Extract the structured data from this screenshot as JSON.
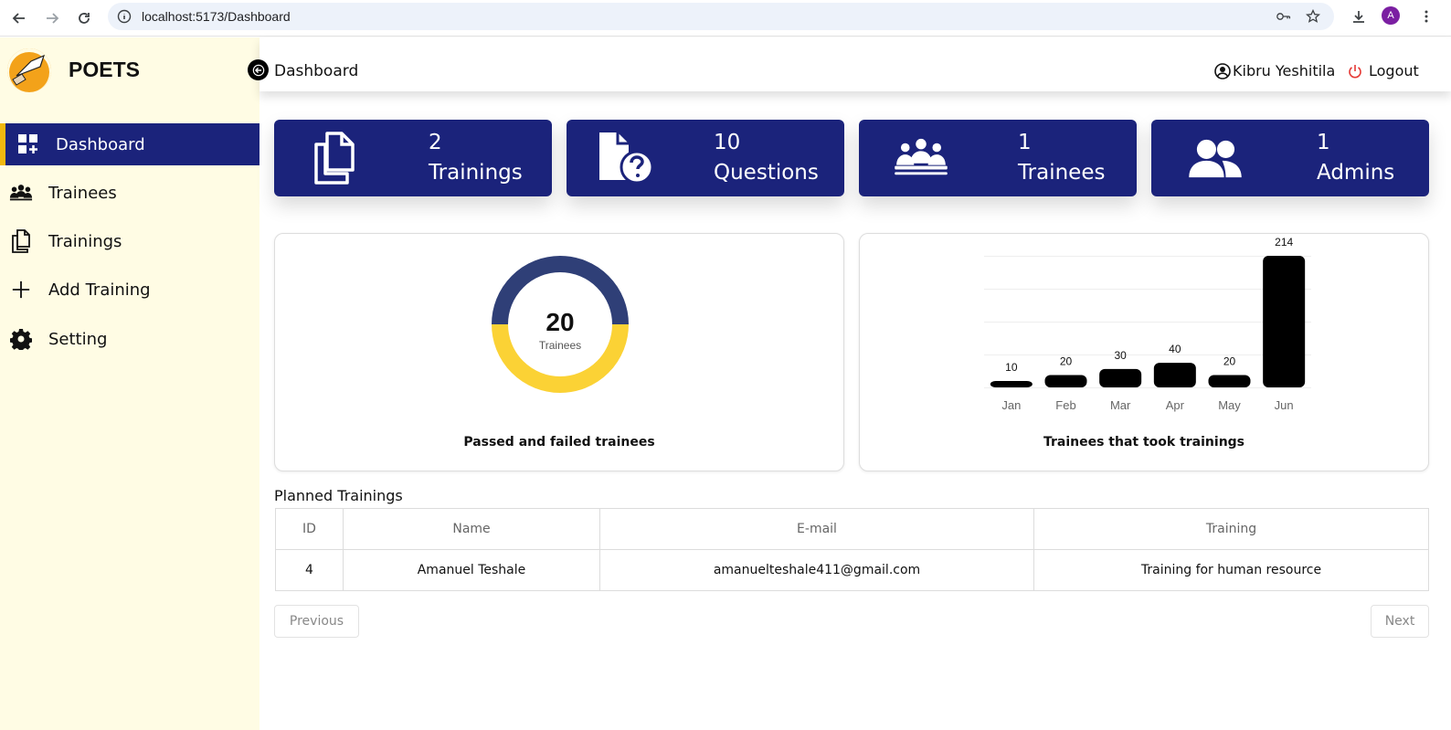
{
  "browser": {
    "url": "localhost:5173/Dashboard",
    "profile_initial": "A"
  },
  "brand": {
    "name": "POETS"
  },
  "sidebar": {
    "items": [
      {
        "label": "Dashboard",
        "icon": "dashboard-icon",
        "active": true
      },
      {
        "label": "Trainees",
        "icon": "people-icon",
        "active": false
      },
      {
        "label": "Trainings",
        "icon": "copy-icon",
        "active": false
      },
      {
        "label": "Add Training",
        "icon": "plus-icon",
        "active": false
      },
      {
        "label": "Setting",
        "icon": "gear-icon",
        "active": false
      }
    ]
  },
  "header": {
    "title": "Dashboard",
    "user_name": "Kibru Yeshitila",
    "logout_label": "Logout"
  },
  "stats": [
    {
      "value": "2",
      "label": "Trainings",
      "icon": "documents-icon"
    },
    {
      "value": "10",
      "label": "Questions",
      "icon": "question-file-icon"
    },
    {
      "value": "1",
      "label": "Trainees",
      "icon": "meeting-icon"
    },
    {
      "value": "1",
      "label": "Admins",
      "icon": "users-icon"
    }
  ],
  "colors": {
    "primary": "#1b237b",
    "accent": "#f2b80f",
    "sidebar_bg": "#fffce4",
    "donut_passed": "#fbd235",
    "donut_failed": "#2f3f77",
    "logout": "#e53935"
  },
  "chart_data": [
    {
      "type": "pie",
      "center_value": "20",
      "center_label": "Trainees",
      "slices": [
        {
          "value": 0.5,
          "color": "#2f3f77"
        },
        {
          "value": 0.5,
          "color": "#fbd235"
        }
      ],
      "caption": "Passed and failed trainees"
    },
    {
      "type": "bar",
      "categories": [
        "Jan",
        "Feb",
        "Mar",
        "Apr",
        "May",
        "Jun"
      ],
      "values": [
        10,
        20,
        30,
        40,
        20,
        214
      ],
      "ylim": [
        0,
        214
      ],
      "grid": true,
      "caption": "Trainees that took trainings"
    }
  ],
  "planned": {
    "title": "Planned Trainings",
    "columns": [
      "ID",
      "Name",
      "E-mail",
      "Training"
    ],
    "rows": [
      [
        "4",
        "Amanuel Teshale",
        "amanuelteshale411@gmail.com",
        "Training for human resource"
      ]
    ],
    "prev_label": "Previous",
    "next_label": "Next"
  }
}
